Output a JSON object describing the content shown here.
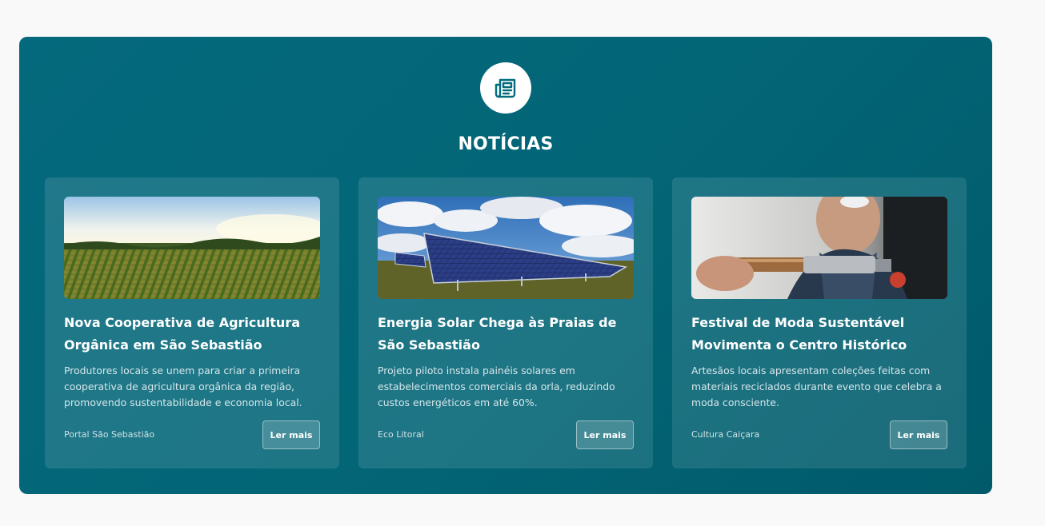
{
  "section": {
    "icon": "newspaper-icon",
    "title": "NOTÍCIAS"
  },
  "colors": {
    "panel": "#036677",
    "badge": "#ffffff",
    "icon": "#046a7d"
  },
  "news": [
    {
      "image": "farm-field-image",
      "title": "Nova Cooperativa de Agricultura Orgânica em São Sebastião",
      "summary": "Produtores locais se unem para criar a primeira cooperativa de agricultura orgânica da região, promovendo sustentabilidade e economia local.",
      "source": "Portal São Sebastião",
      "button": "Ler mais"
    },
    {
      "image": "solar-panels-image",
      "title": "Energia Solar Chega às Praias de São Sebastião",
      "summary": "Projeto piloto instala painéis solares em estabelecimentos comerciais da orla, reduzindo custos energéticos em até 60%.",
      "source": "Eco Litoral",
      "button": "Ler mais"
    },
    {
      "image": "artisan-craft-image",
      "title": "Festival de Moda Sustentável Movimenta o Centro Histórico",
      "summary": "Artesãos locais apresentam coleções feitas com materiais reciclados durante evento que celebra a moda consciente.",
      "source": "Cultura Caiçara",
      "button": "Ler mais"
    }
  ]
}
